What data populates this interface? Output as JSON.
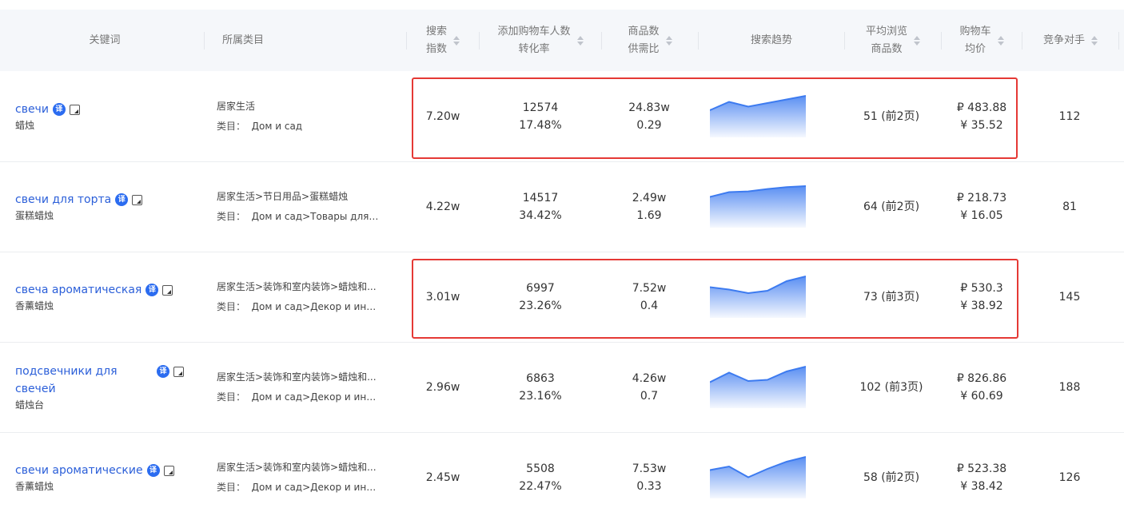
{
  "header": {
    "keyword": "关键词",
    "category": "所属类目",
    "search_index": [
      "搜索",
      "指数"
    ],
    "cart_conv": [
      "添加购物车人数",
      "转化率"
    ],
    "supply_ratio": [
      "商品数",
      "供需比"
    ],
    "trend": "搜索趋势",
    "avg_browse": [
      "平均浏览",
      "商品数"
    ],
    "cart_price": [
      "购物车",
      "均价"
    ],
    "competitors": "竞争对手"
  },
  "rows": [
    {
      "keyword": "свечи",
      "keyword_cont": "",
      "translation": "蜡烛",
      "badge": "译",
      "category_path": "居家生活",
      "category_label": "类目：",
      "category_ru": "Дом и сад",
      "search_index": "7.20w",
      "cart_users": "12574",
      "conversion": "17.48%",
      "goods_count": "24.83w",
      "supply_demand": "0.29",
      "trend": [
        0.4,
        0.75,
        0.55,
        0.7,
        0.85,
        1.0
      ],
      "avg_browse": "51 (前2页)",
      "price_rub": "₽ 483.88",
      "price_cny": "¥ 35.52",
      "competitors": "112"
    },
    {
      "keyword": "свечи для торта",
      "keyword_cont": "",
      "translation": "蛋糕蜡烛",
      "badge": "译",
      "category_path": "居家生活>节日用品>蛋糕蜡烛",
      "category_label": "类目：",
      "category_ru": "Дом и сад>Товары для п...",
      "search_index": "4.22w",
      "cart_users": "14517",
      "conversion": "34.42%",
      "goods_count": "2.49w",
      "supply_demand": "1.69",
      "trend": [
        0.55,
        0.75,
        0.78,
        0.88,
        0.96,
        1.0
      ],
      "avg_browse": "64 (前2页)",
      "price_rub": "₽ 218.73",
      "price_cny": "¥ 16.05",
      "competitors": "81"
    },
    {
      "keyword": "свеча ароматическая",
      "keyword_cont": "",
      "translation": "香薰蜡烛",
      "badge": "译",
      "category_path": "居家生活>装饰和室内装饰>蜡烛和...",
      "category_label": "类目：",
      "category_ru": "Дом и сад>Декор и инте...",
      "search_index": "3.01w",
      "cart_users": "6997",
      "conversion": "23.26%",
      "goods_count": "7.52w",
      "supply_demand": "0.4",
      "trend": [
        0.55,
        0.45,
        0.3,
        0.4,
        0.8,
        1.0
      ],
      "avg_browse": "73 (前3页)",
      "price_rub": "₽ 530.3",
      "price_cny": "¥ 38.92",
      "competitors": "145"
    },
    {
      "keyword": "подсвечники для",
      "keyword_cont": "свечей",
      "translation": "蜡烛台",
      "badge": "译",
      "category_path": "居家生活>装饰和室内装饰>蜡烛和...",
      "category_label": "类目：",
      "category_ru": "Дом и сад>Декор и инте...",
      "search_index": "2.96w",
      "cart_users": "6863",
      "conversion": "23.16%",
      "goods_count": "4.26w",
      "supply_demand": "0.7",
      "trend": [
        0.35,
        0.75,
        0.4,
        0.45,
        0.8,
        1.0
      ],
      "avg_browse": "102 (前3页)",
      "price_rub": "₽ 826.86",
      "price_cny": "¥ 60.69",
      "competitors": "188"
    },
    {
      "keyword": "свечи ароматические",
      "keyword_cont": "",
      "translation": "香薰蜡烛",
      "badge": "译",
      "category_path": "居家生活>装饰和室内装饰>蜡烛和...",
      "category_label": "类目：",
      "category_ru": "Дом и сад>Декор и инте...",
      "search_index": "2.45w",
      "cart_users": "5508",
      "conversion": "22.47%",
      "goods_count": "7.53w",
      "supply_demand": "0.33",
      "trend": [
        0.45,
        0.6,
        0.15,
        0.5,
        0.8,
        1.0
      ],
      "avg_browse": "58 (前2页)",
      "price_rub": "₽ 523.38",
      "price_cny": "¥ 38.42",
      "competitors": "126"
    }
  ],
  "colors": {
    "accent": "#2b5fd9",
    "trend_line": "#3d7bf0",
    "highlight": "#e53935",
    "header_bg": "#f5f7fa"
  }
}
